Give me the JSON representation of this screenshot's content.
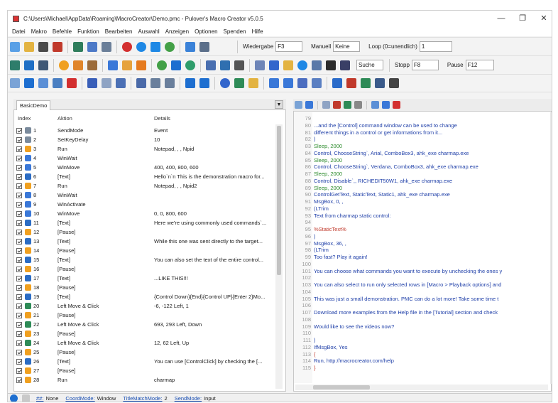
{
  "window": {
    "title": "C:\\Users\\Michael\\AppData\\Roaming\\MacroCreator\\Demo.pmc - Pulover's Macro Creator v5.0.5",
    "minimize": "—",
    "restore": "❐",
    "close": "✕"
  },
  "menu": [
    "Datei",
    "Makro",
    "Befehle",
    "Funktion",
    "Bearbeiten",
    "Auswahl",
    "Anzeigen",
    "Optionen",
    "Spenden",
    "Hilfe"
  ],
  "toolbar1": {
    "wiedergabe_label": "Wiedergabe",
    "wiedergabe_value": "F3",
    "manuell_label": "Manuell",
    "manuell_value": "Keine",
    "loop_label": "Loop (0=unendlich)",
    "loop_value": "1"
  },
  "toolbar2": {
    "search_value": "Suche",
    "stopp_label": "Stopp",
    "stopp_value": "F8",
    "pause_label": "Pause",
    "pause_value": "F12"
  },
  "tabs": {
    "active": "BasicDemo"
  },
  "table": {
    "headers": {
      "index": "Index",
      "action": "Aktion",
      "details": "Details"
    },
    "rows": [
      {
        "index": "1",
        "action": "SendMode",
        "details": "Event",
        "color": "#7a8a9c"
      },
      {
        "index": "2",
        "action": "SetKeyDelay",
        "details": "10",
        "color": "#7a8a9c"
      },
      {
        "index": "3",
        "action": "Run",
        "details": "Notepad, , , Npid",
        "color": "#f0a020"
      },
      {
        "index": "4",
        "action": "WinWait",
        "details": "",
        "color": "#3a78d8"
      },
      {
        "index": "5",
        "action": "WinMove",
        "details": "400, 400, 800, 600",
        "color": "#3a78d8"
      },
      {
        "index": "6",
        "action": "[Text]",
        "details": "Hello`n`n This is the demonstration macro for...",
        "color": "#2b6cc4"
      },
      {
        "index": "7",
        "action": "Run",
        "details": "Notepad, , , Npid2",
        "color": "#f0a020"
      },
      {
        "index": "8",
        "action": "WinWait",
        "details": "",
        "color": "#3a78d8"
      },
      {
        "index": "9",
        "action": "WinActivate",
        "details": "",
        "color": "#3a78d8"
      },
      {
        "index": "10",
        "action": "WinMove",
        "details": "0, 0, 800, 600",
        "color": "#3a78d8"
      },
      {
        "index": "11",
        "action": "[Text]",
        "details": "Here we're using commonly used commands`...",
        "color": "#2b6cc4"
      },
      {
        "index": "12",
        "action": "[Pause]",
        "details": "",
        "color": "#f0a020"
      },
      {
        "index": "13",
        "action": "[Text]",
        "details": "While this one was sent directly to the target...",
        "color": "#2b6cc4"
      },
      {
        "index": "14",
        "action": "[Pause]",
        "details": "",
        "color": "#f0a020"
      },
      {
        "index": "15",
        "action": "[Text]",
        "details": "You can also set the text of the entire control...",
        "color": "#2b6cc4"
      },
      {
        "index": "16",
        "action": "[Pause]",
        "details": "",
        "color": "#f0a020"
      },
      {
        "index": "17",
        "action": "[Text]",
        "details": "...LIKE THIS!!!",
        "color": "#2b6cc4"
      },
      {
        "index": "18",
        "action": "[Pause]",
        "details": "",
        "color": "#f0a020"
      },
      {
        "index": "19",
        "action": "[Text]",
        "details": "{Control Down}{End}{Control UP}{Enter 2}Mo...",
        "color": "#2b6cc4"
      },
      {
        "index": "20",
        "action": "Left Move & Click",
        "details": "-6, -122 Left, 1",
        "color": "#2e8b57"
      },
      {
        "index": "21",
        "action": "[Pause]",
        "details": "",
        "color": "#f0a020"
      },
      {
        "index": "22",
        "action": "Left Move & Click",
        "details": "693, 293 Left, Down",
        "color": "#2e8b57"
      },
      {
        "index": "23",
        "action": "[Pause]",
        "details": "",
        "color": "#f0a020"
      },
      {
        "index": "24",
        "action": "Left Move & Click",
        "details": "12, 62 Left, Up",
        "color": "#2e8b57"
      },
      {
        "index": "25",
        "action": "[Pause]",
        "details": "",
        "color": "#f0a020"
      },
      {
        "index": "26",
        "action": "[Text]",
        "details": "You can use [ControlClick] by checking the [...",
        "color": "#2b6cc4"
      },
      {
        "index": "27",
        "action": "[Pause]",
        "details": "",
        "color": "#f0a020"
      },
      {
        "index": "28",
        "action": "Run",
        "details": "charmap",
        "color": "#f0a020"
      }
    ]
  },
  "code": [
    {
      "ln": "79",
      "text": "",
      "color": "#333333"
    },
    {
      "ln": "80",
      "text": "...and the [Control] command window can be used to change",
      "color": "#1f3fa8"
    },
    {
      "ln": "81",
      "text": "different things in a control or get informations from it...",
      "color": "#1f3fa8"
    },
    {
      "ln": "82",
      "text": ")",
      "color": "#1f3fa8"
    },
    {
      "ln": "83",
      "text": "Sleep, 2000",
      "color": "#2a8a2a"
    },
    {
      "ln": "84",
      "text": "Control, ChooseString`, Arial, ComboBox3, ahk_exe charmap.exe",
      "color": "#1f3fa8"
    },
    {
      "ln": "85",
      "text": "Sleep, 2000",
      "color": "#2a8a2a"
    },
    {
      "ln": "86",
      "text": "Control, ChooseString`, Verdana, ComboBox3, ahk_exe charmap.exe",
      "color": "#1f3fa8"
    },
    {
      "ln": "87",
      "text": "Sleep, 2000",
      "color": "#2a8a2a"
    },
    {
      "ln": "88",
      "text": "Control, Disable`,, RICHEDIT50W1, ahk_exe charmap.exe",
      "color": "#1f3fa8"
    },
    {
      "ln": "89",
      "text": "Sleep, 2000",
      "color": "#2a8a2a"
    },
    {
      "ln": "90",
      "text": "ControlGetText, StaticText, Static1, ahk_exe charmap.exe",
      "color": "#1f3fa8"
    },
    {
      "ln": "91",
      "text": "MsgBox, 0, ,",
      "color": "#1f3fa8"
    },
    {
      "ln": "92",
      "text": "(LTrim",
      "color": "#1f3fa8"
    },
    {
      "ln": "93",
      "text": "Text from charmap static control:",
      "color": "#1f3fa8"
    },
    {
      "ln": "94",
      "text": "",
      "color": "#333333"
    },
    {
      "ln": "95",
      "text": "%StaticText%",
      "color": "#c0392b"
    },
    {
      "ln": "96",
      "text": ")",
      "color": "#1f3fa8"
    },
    {
      "ln": "97",
      "text": "MsgBox, 36, ,",
      "color": "#1f3fa8"
    },
    {
      "ln": "98",
      "text": "(LTrim",
      "color": "#1f3fa8"
    },
    {
      "ln": "99",
      "text": "Too fast? Play it again!",
      "color": "#1f3fa8"
    },
    {
      "ln": "100",
      "text": "",
      "color": "#333333"
    },
    {
      "ln": "101",
      "text": "You can choose what commands you want to execute by unchecking the ones y",
      "color": "#1f3fa8"
    },
    {
      "ln": "102",
      "text": "",
      "color": "#333333"
    },
    {
      "ln": "103",
      "text": "You can also select to run only selected rows in [Macro > Playback options] and",
      "color": "#1f3fa8"
    },
    {
      "ln": "104",
      "text": "",
      "color": "#333333"
    },
    {
      "ln": "105",
      "text": "This was just a small demonstration. PMC can do a lot more! Take some time t",
      "color": "#1f3fa8"
    },
    {
      "ln": "106",
      "text": "",
      "color": "#333333"
    },
    {
      "ln": "107",
      "text": "Download more examples from the Help file in the [Tutorial] section and check",
      "color": "#1f3fa8"
    },
    {
      "ln": "108",
      "text": "",
      "color": "#333333"
    },
    {
      "ln": "109",
      "text": "Would like to see the videos now?",
      "color": "#1f3fa8"
    },
    {
      "ln": "110",
      "text": "",
      "color": "#333333"
    },
    {
      "ln": "111",
      "text": ")",
      "color": "#1f3fa8"
    },
    {
      "ln": "112",
      "text": "IfMsgBox, Yes",
      "color": "#1f3fa8"
    },
    {
      "ln": "113",
      "text": "{",
      "color": "#c0392b"
    },
    {
      "ln": "114",
      "text": "    Run, http://macrocreator.com/help",
      "color": "#1f3fa8"
    },
    {
      "ln": "115",
      "text": "}",
      "color": "#c0392b"
    }
  ],
  "status": {
    "hash": "##:",
    "hash_value": "None",
    "coord_label": "CoordMode:",
    "coord_value": "Window",
    "title_label": "TitleMatchMode:",
    "title_value": "2",
    "send_label": "SendMode:",
    "send_value": "Input"
  }
}
